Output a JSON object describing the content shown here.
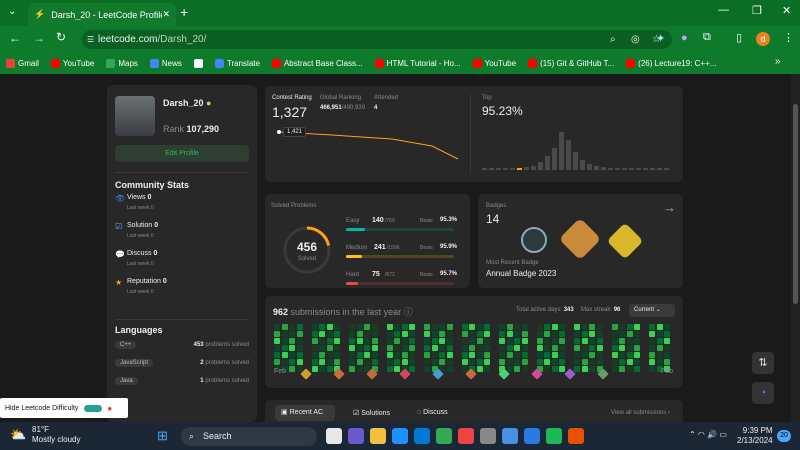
{
  "browser": {
    "tab_title": "Darsh_20 - LeetCode Profile",
    "url_prefix": "leetcode.com",
    "url_path": "/Darsh_20/",
    "profile_initial": "d"
  },
  "bookmarks": [
    "Gmail",
    "YouTube",
    "Maps",
    "News",
    "",
    "Translate",
    "Abstract Base Class...",
    "HTML Tutorial - Ho...",
    "YouTube",
    "(15) Git & GitHub T...",
    "(26) Lecture19: C++..."
  ],
  "profile": {
    "username": "Darsh_20",
    "rank_label": "Rank",
    "rank": "107,290",
    "edit_label": "Edit Profile"
  },
  "community": {
    "title": "Community Stats",
    "items": [
      {
        "label": "Views",
        "value": "0",
        "sub": "Last week 0"
      },
      {
        "label": "Solution",
        "value": "0",
        "sub": "Last week 0"
      },
      {
        "label": "Discuss",
        "value": "0",
        "sub": "Last week 0"
      },
      {
        "label": "Reputation",
        "value": "0",
        "sub": "Last week 0"
      }
    ]
  },
  "languages": {
    "title": "Languages",
    "items": [
      {
        "lang": "C++",
        "count": "453",
        "suffix": "problems solved"
      },
      {
        "lang": "JavaScript",
        "count": "2",
        "suffix": "problems solved"
      },
      {
        "lang": "Java",
        "count": "1",
        "suffix": "problems solved"
      }
    ]
  },
  "contest": {
    "rating_label": "Contest Rating",
    "rating": "1,327",
    "global_label": "Global Ranking",
    "global": "466,951",
    "global_total": "/490,939",
    "attended_label": "Attended",
    "attended": "4",
    "tooltip": "1,421",
    "top_label": "Top",
    "top": "95.23%"
  },
  "solved": {
    "title": "Solved Problems",
    "total": "456",
    "total_label": "Solved",
    "easy": {
      "label": "Easy",
      "count": "140",
      "total": "/769",
      "beats": "95.3%",
      "frac": 0.18
    },
    "medium": {
      "label": "Medium",
      "count": "241",
      "total": "/1596",
      "beats": "95.9%",
      "frac": 0.15
    },
    "hard": {
      "label": "Hard",
      "count": "75",
      "total": "/672",
      "beats": "95.7%",
      "frac": 0.11
    },
    "beats_label": "Beats"
  },
  "badges": {
    "title": "Badges",
    "count": "14",
    "recent_label": "Most Recent Badge",
    "recent": "Annual Badge 2023"
  },
  "submissions": {
    "count": "962",
    "text": "submissions in the last year",
    "active_label": "Total active days:",
    "active": "343",
    "streak_label": "Max streak:",
    "streak": "96",
    "select": "Current",
    "month_start": "Feb",
    "month_end": "Feb"
  },
  "tabs": {
    "recent": "Recent AC",
    "solutions": "Solutions",
    "discuss": "Discuss",
    "view_all": "View all submissions"
  },
  "popup": {
    "label": "Hide Leetcode Difficulty"
  },
  "taskbar": {
    "temp": "81°F",
    "weather": "Mostly cloudy",
    "search": "Search",
    "time": "9:39 PM",
    "date": "2/13/2024",
    "badge": "20"
  },
  "colors": {
    "easy": "#00b8a3",
    "medium": "#ffc01e",
    "hard": "#ef4743",
    "accent": "#ffa116"
  }
}
